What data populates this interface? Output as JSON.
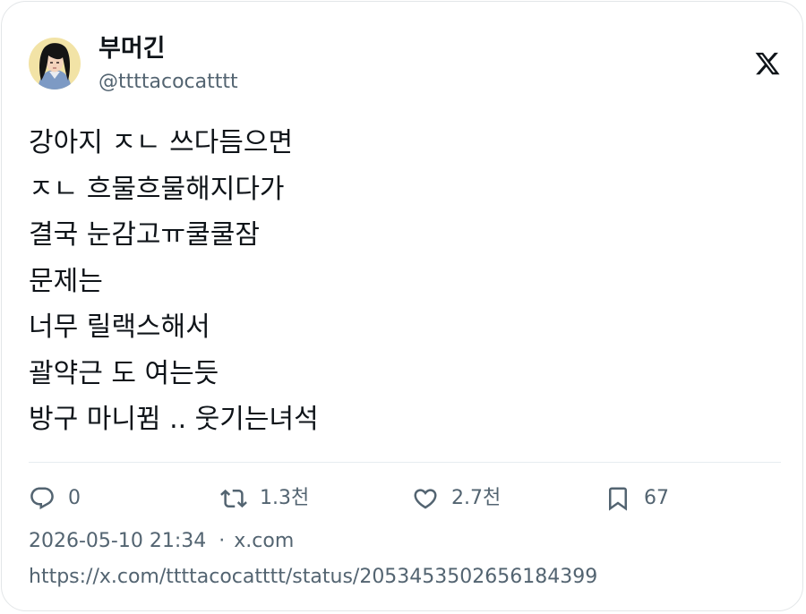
{
  "author": {
    "display_name": "부머긴",
    "handle": "@ttttacocatttt",
    "avatar": "avatar-illustration"
  },
  "header": {
    "brand_icon": "x-logo-icon"
  },
  "tweet": {
    "lines": [
      "강아지 ㅈㄴ 쓰다듬으면",
      "ㅈㄴ 흐물흐물해지다가",
      "결국 눈감고ㅠ쿨쿨잠",
      "문제는",
      "너무 릴랙스해서",
      "괄약근 도 여는듯",
      "방구 마니뀜 .. 웃기는녀석"
    ]
  },
  "actions": {
    "reply": {
      "icon": "reply-icon",
      "count": "0"
    },
    "retweet": {
      "icon": "retweet-icon",
      "count": "1.3천"
    },
    "like": {
      "icon": "heart-icon",
      "count": "2.7천"
    },
    "bookmark": {
      "icon": "bookmark-icon",
      "count": "67"
    }
  },
  "meta": {
    "timestamp": "2026-05-10 21:34",
    "separator": "·",
    "source": "x.com"
  },
  "link": {
    "url": "https://x.com/ttttacocatttt/status/2053453502656184399"
  },
  "colors": {
    "text_primary": "#0f1419",
    "text_secondary": "#536471",
    "divider": "#e6ecf0",
    "card_border": "#e3e6e8"
  }
}
